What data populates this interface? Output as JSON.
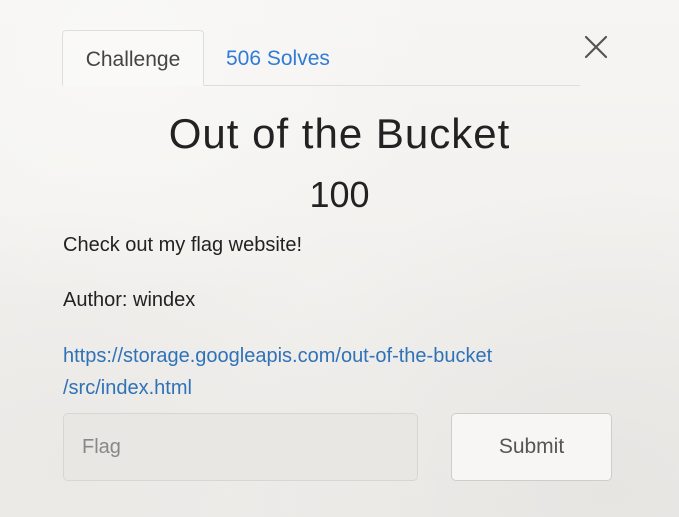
{
  "tabs": {
    "challenge_label": "Challenge",
    "solves_label": "506 Solves"
  },
  "close_icon": "close-icon",
  "challenge": {
    "name": "Out of the Bucket",
    "points": "100",
    "description_lines": [
      "Check out my flag website!",
      "Author: windex"
    ],
    "link_line_1": "https://storage.googleapis.com/out-of-the-bucket",
    "link_line_2": "/src/index.html"
  },
  "form": {
    "flag_placeholder": "Flag",
    "submit_label": "Submit"
  },
  "colors": {
    "link": "#2f72b8",
    "tab_active_text": "#444444",
    "tab_link_text": "#2f7bd6",
    "input_background": "#e9e7e4"
  }
}
